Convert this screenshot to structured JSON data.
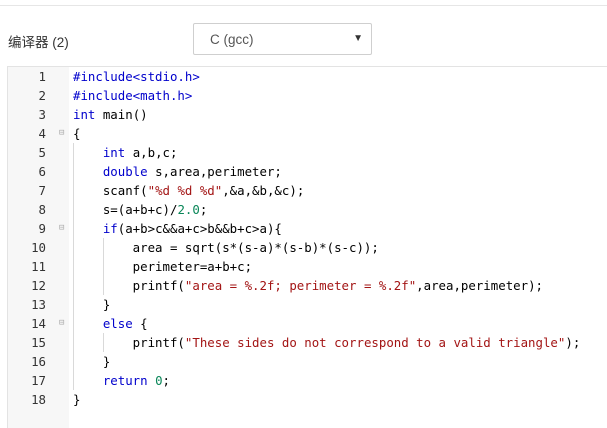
{
  "compiler": {
    "label": "编译器 (2)",
    "selected": "C (gcc)"
  },
  "colors": {
    "keyword": "#0000cc",
    "string": "#a31515",
    "number": "#098658",
    "gutter_bg": "#f7f7f7"
  },
  "editor": {
    "lines": [
      {
        "num": "1",
        "fold": "",
        "tokens": [
          {
            "t": "#include<stdio.h>",
            "c": "#0000cc"
          }
        ]
      },
      {
        "num": "2",
        "fold": "",
        "tokens": [
          {
            "t": "#include<math.h>",
            "c": "#0000cc"
          }
        ]
      },
      {
        "num": "3",
        "fold": "",
        "tokens": [
          {
            "t": "int",
            "c": "#0000cc"
          },
          {
            "t": " main()"
          }
        ]
      },
      {
        "num": "4",
        "fold": "⊟",
        "tokens": [
          {
            "t": "{"
          }
        ]
      },
      {
        "num": "5",
        "fold": "",
        "tokens": [
          {
            "t": "    "
          },
          {
            "t": "int",
            "c": "#0000cc"
          },
          {
            "t": " a,b,c;"
          }
        ]
      },
      {
        "num": "6",
        "fold": "",
        "tokens": [
          {
            "t": "    "
          },
          {
            "t": "double",
            "c": "#0000cc"
          },
          {
            "t": " s,area,perimeter;"
          }
        ]
      },
      {
        "num": "7",
        "fold": "",
        "tokens": [
          {
            "t": "    scanf("
          },
          {
            "t": "\"%d %d %d\"",
            "c": "#a31515"
          },
          {
            "t": ",&a,&b,&c);"
          }
        ]
      },
      {
        "num": "8",
        "fold": "",
        "tokens": [
          {
            "t": "    s=(a+b+c)/"
          },
          {
            "t": "2.0",
            "c": "#098658"
          },
          {
            "t": ";"
          }
        ]
      },
      {
        "num": "9",
        "fold": "⊟",
        "tokens": [
          {
            "t": "    "
          },
          {
            "t": "if",
            "c": "#0000cc"
          },
          {
            "t": "(a+b>c&&a+c>b&&b+c>a){"
          }
        ]
      },
      {
        "num": "10",
        "fold": "",
        "tokens": [
          {
            "t": "        area = sqrt(s*(s-a)*(s-b)*(s-c));"
          }
        ]
      },
      {
        "num": "11",
        "fold": "",
        "tokens": [
          {
            "t": "        perimeter=a+b+c;"
          }
        ]
      },
      {
        "num": "12",
        "fold": "",
        "tokens": [
          {
            "t": "        printf("
          },
          {
            "t": "\"area = %.2f; perimeter = %.2f\"",
            "c": "#a31515"
          },
          {
            "t": ",area,perimeter);"
          }
        ]
      },
      {
        "num": "13",
        "fold": "",
        "tokens": [
          {
            "t": "    }"
          }
        ]
      },
      {
        "num": "14",
        "fold": "⊟",
        "tokens": [
          {
            "t": "    "
          },
          {
            "t": "else",
            "c": "#0000cc"
          },
          {
            "t": " {"
          }
        ]
      },
      {
        "num": "15",
        "fold": "",
        "tokens": [
          {
            "t": "        printf("
          },
          {
            "t": "\"These sides do not correspond to a valid triangle\"",
            "c": "#a31515"
          },
          {
            "t": ");"
          }
        ]
      },
      {
        "num": "16",
        "fold": "",
        "tokens": [
          {
            "t": "    }"
          }
        ]
      },
      {
        "num": "17",
        "fold": "",
        "tokens": [
          {
            "t": "    "
          },
          {
            "t": "return",
            "c": "#0000cc"
          },
          {
            "t": " "
          },
          {
            "t": "0",
            "c": "#098658"
          },
          {
            "t": ";"
          }
        ]
      },
      {
        "num": "18",
        "fold": "",
        "tokens": [
          {
            "t": "}"
          }
        ]
      }
    ]
  }
}
